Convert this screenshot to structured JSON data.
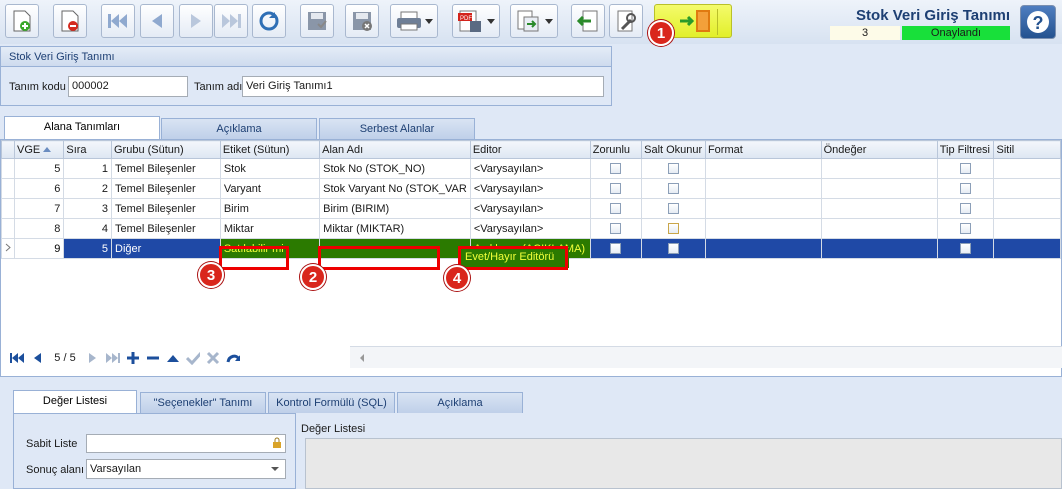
{
  "toolbar": {
    "buttons": [
      {
        "name": "new-button",
        "icon": "new-doc-icon"
      },
      {
        "name": "delete-button",
        "icon": "delete-doc-icon"
      },
      {
        "name": "first-record-button",
        "icon": "first-icon"
      },
      {
        "name": "prev-record-button",
        "icon": "prev-icon"
      },
      {
        "name": "next-record-button",
        "icon": "next-icon"
      },
      {
        "name": "last-record-button",
        "icon": "last-icon"
      },
      {
        "name": "refresh-button",
        "icon": "refresh-icon"
      },
      {
        "name": "save-button",
        "icon": "save-icon"
      },
      {
        "name": "cancel-save-button",
        "icon": "save-cancel-icon"
      },
      {
        "name": "print-button",
        "icon": "printer-icon"
      },
      {
        "name": "export-pdf-button",
        "icon": "pdf-icon"
      },
      {
        "name": "export-button",
        "icon": "export-icon"
      },
      {
        "name": "import-button",
        "icon": "import-icon"
      },
      {
        "name": "tools-button",
        "icon": "wrench-icon"
      },
      {
        "name": "exit-button",
        "icon": "exit-door-icon"
      }
    ]
  },
  "header": {
    "title": "Stok Veri Giriş Tanımı",
    "record_index": "3",
    "status": "Onaylandı",
    "status_color": "#18e03a"
  },
  "markers": [
    "1",
    "2",
    "3",
    "4"
  ],
  "form": {
    "panel_title": "Stok Veri Giriş Tanımı",
    "code_label": "Tanım kodu",
    "code_value": "000002",
    "name_label": "Tanım adı",
    "name_value": "Veri Giriş Tanımı1"
  },
  "tabs": [
    "Alana Tanımları",
    "Açıklama",
    "Serbest Alanlar"
  ],
  "grid": {
    "columns": [
      "VGE",
      "Sıra",
      "Grubu (Sütun)",
      "Etiket (Sütun)",
      "Alan Adı",
      "Editor",
      "Zorunlu",
      "Salt Okunur",
      "Format",
      "Öndeğer",
      "Tip Filtresi",
      "Sitil"
    ],
    "rows": [
      {
        "vge": "5",
        "sira": "1",
        "grubu": "Temel Bileşenler",
        "etiket": "Stok",
        "alan": "Stok No (STOK_NO)",
        "editor": "<Varysayılan>"
      },
      {
        "vge": "6",
        "sira": "2",
        "grubu": "Temel Bileşenler",
        "etiket": "Varyant",
        "alan": "Stok Varyant No (STOK_VAR",
        "editor": "<Varysayılan>"
      },
      {
        "vge": "7",
        "sira": "3",
        "grubu": "Temel Bileşenler",
        "etiket": "Birim",
        "alan": "Birim (BIRIM)",
        "editor": "<Varysayılan>"
      },
      {
        "vge": "8",
        "sira": "4",
        "grubu": "Temel Bileşenler",
        "etiket": "Miktar",
        "alan": "Miktar (MIKTAR)",
        "editor": "<Varysayılan>"
      },
      {
        "vge": "9",
        "sira": "5",
        "grubu": "Diğer",
        "etiket": "Satılabilir mi",
        "alan": "Açıklama (ACIKLAMA)",
        "editor": "Evet/Hayır Editörü"
      }
    ],
    "selected_color": "#1f49a6",
    "edited_color": "#2b7a00",
    "highlight_color": "#e00000"
  },
  "navigator": {
    "position": "5 / 5"
  },
  "lower_tabs": [
    "Değer Listesi",
    "\"Seçenekler\" Tanımı",
    "Kontrol Formülü (SQL)",
    "Açıklama"
  ],
  "lower": {
    "list_label": "Sabit Liste",
    "result_label": "Sonuç alanı",
    "result_value": "Varsayılan",
    "right_label": "Değer Listesi"
  }
}
